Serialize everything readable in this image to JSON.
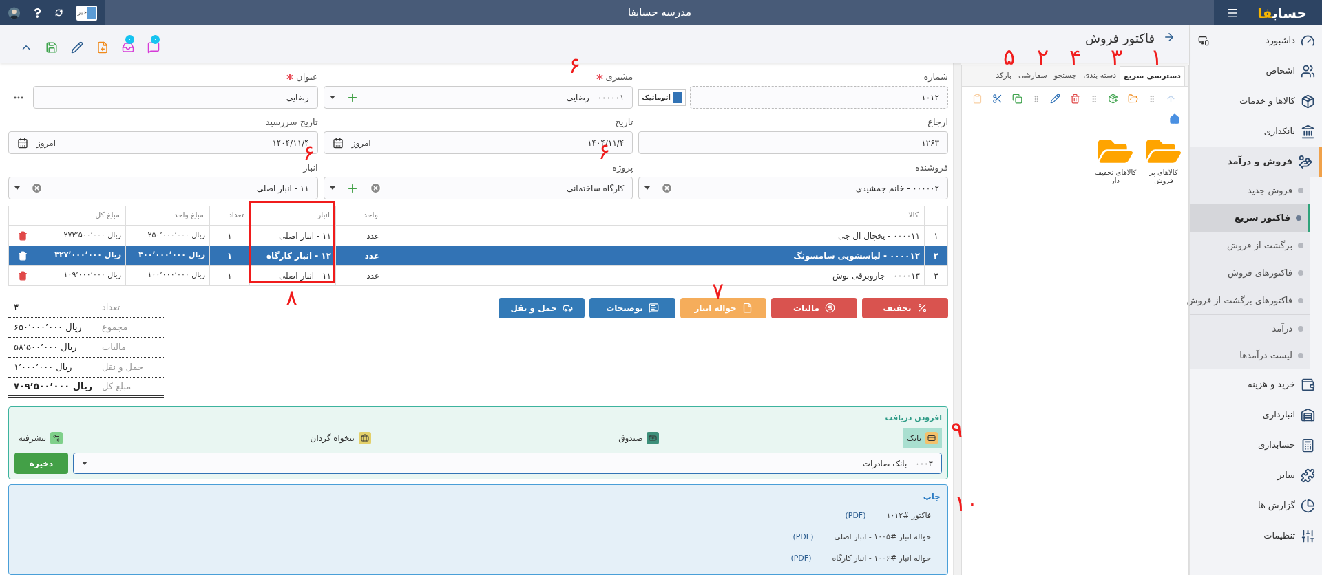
{
  "top_bar": {
    "logo": {
      "text": "حساب",
      "accent": "فا"
    },
    "title": "مدرسه حسابفا",
    "toggle": {
      "label": "خیر",
      "on": false
    }
  },
  "toolbar": [
    {
      "kind": "chat",
      "badge": "۰"
    },
    {
      "kind": "inbox",
      "badge": "۰"
    },
    {
      "kind": "new-file"
    },
    {
      "kind": "edit"
    },
    {
      "kind": "save"
    },
    {
      "kind": "collapse"
    }
  ],
  "sidebar": {
    "items": [
      {
        "label": "داشبورد",
        "kind": "dashboard",
        "expanded": false
      },
      {
        "label": "اشخاص",
        "kind": "people",
        "expanded": false
      },
      {
        "label": "کالاها و خدمات",
        "kind": "products",
        "expanded": false
      },
      {
        "label": "بانکداری",
        "kind": "banking",
        "expanded": false
      },
      {
        "label": "فروش و درآمد",
        "kind": "sales",
        "expanded": true,
        "children": [
          {
            "label": "فروش جدید",
            "selected": false,
            "kind": "item"
          },
          {
            "label": "فاکتور سریع",
            "selected": true,
            "kind": "item"
          },
          {
            "label": "برگشت از فروش",
            "selected": false,
            "kind": "item"
          },
          {
            "label": "فاکتورهای فروش",
            "selected": false,
            "kind": "item"
          },
          {
            "label": "فاکتورهای برگشت از فروش",
            "selected": false,
            "kind": "item"
          },
          {
            "label": "درآمد",
            "selected": false,
            "kind": "section-start"
          },
          {
            "label": "لیست درآمدها",
            "selected": false,
            "kind": "item"
          }
        ]
      },
      {
        "label": "خرید و هزینه",
        "kind": "purchases",
        "expanded": false
      },
      {
        "label": "انبارداری",
        "kind": "inventory",
        "expanded": false
      },
      {
        "label": "حسابداری",
        "kind": "accounting",
        "expanded": false
      },
      {
        "label": "سایر",
        "kind": "other",
        "expanded": false
      },
      {
        "label": "گزارش ها",
        "kind": "reports",
        "expanded": false
      },
      {
        "label": "تنظیمات",
        "kind": "settings",
        "expanded": false
      }
    ]
  },
  "quick_panel": {
    "title": "فاکتور فروش",
    "tabs": [
      {
        "label": "دسترسی سریع",
        "selected": true
      },
      {
        "label": "دسته بندی",
        "selected": false
      },
      {
        "label": "جستجو",
        "selected": false
      },
      {
        "label": "سفارشی",
        "selected": false
      },
      {
        "label": "بارکد",
        "selected": false
      }
    ],
    "tools": [
      {
        "kind": "up",
        "disabled": true
      },
      {
        "kind": "grip",
        "disabled": false
      },
      {
        "kind": "open-folder",
        "disabled": false
      },
      {
        "kind": "add",
        "disabled": false
      },
      {
        "kind": "grip",
        "disabled": false
      },
      {
        "kind": "delete",
        "disabled": false
      },
      {
        "kind": "edit",
        "disabled": false
      },
      {
        "kind": "grip",
        "disabled": false
      },
      {
        "kind": "copy",
        "disabled": false
      },
      {
        "kind": "cut",
        "disabled": false
      },
      {
        "kind": "paste",
        "disabled": true
      }
    ],
    "folders": [
      {
        "label": "کالاهای پر فروش"
      },
      {
        "label": "کالاهای تخفیف دار"
      }
    ]
  },
  "form": {
    "fields": [
      {
        "label": "شماره",
        "kind": "number",
        "required": false,
        "value": "۱۰۱۲",
        "auto": {
          "label": "اتوماتیک",
          "checked": true
        }
      },
      {
        "label": "مشتری",
        "kind": "select",
        "required": true,
        "value": "۰۰۰۰۰۱ - رضایی",
        "clearable": false,
        "addable": true
      },
      {
        "label": "عنوان",
        "kind": "text",
        "required": true,
        "value": "رضایی",
        "more": true
      },
      {
        "label": "ارجاع",
        "kind": "text",
        "required": false,
        "value": "۱۲۶۳",
        "more": false
      },
      {
        "label": "تاریخ",
        "kind": "date",
        "required": false,
        "value": "۱۴۰۴/۱۱/۴",
        "today": "امروز"
      },
      {
        "label": "تاریخ سررسید",
        "kind": "date",
        "required": false,
        "value": "۱۴۰۴/۱۱/۴",
        "today": "امروز"
      },
      {
        "label": "فروشنده",
        "kind": "select",
        "required": false,
        "value": "۰۰۰۰۰۲ - خانم جمشیدی",
        "clearable": true,
        "addable": false
      },
      {
        "label": "پروژه",
        "kind": "select",
        "required": false,
        "value": "کارگاه ساختمانی",
        "clearable": true,
        "addable": true
      },
      {
        "label": "انبار",
        "kind": "select",
        "required": false,
        "value": "۱۱ - انبار اصلی",
        "clearable": true,
        "addable": false
      }
    ]
  },
  "table": {
    "columns": [
      "کالا",
      "واحد",
      "انبار",
      "تعداد",
      "مبلغ واحد",
      "مبلغ کل"
    ],
    "rows": [
      {
        "index": "۱",
        "cells": [
          "۰۰۰۰۱۱ - یخچال ال جی",
          "عدد",
          "۱۱ - انبار اصلی",
          "۱",
          "ریال ۲۵۰٬۰۰۰٬۰۰۰",
          "ریال ۲۷۲٬۵۰۰٬۰۰۰"
        ],
        "selected": false
      },
      {
        "index": "۲",
        "cells": [
          "۰۰۰۰۱۲ - لباسشویی سامسونگ",
          "عدد",
          "۱۲ - انبار کارگاه",
          "۱",
          "ریال ۳۰۰٬۰۰۰٬۰۰۰",
          "ریال ۳۲۷٬۰۰۰٬۰۰۰"
        ],
        "selected": true
      },
      {
        "index": "۳",
        "cells": [
          "۰۰۰۰۱۳ - جاروبرقی بوش",
          "عدد",
          "۱۱ - انبار اصلی",
          "۱",
          "ریال ۱۰۰٬۰۰۰٬۰۰۰",
          "ریال ۱۰۹٬۰۰۰٬۰۰۰"
        ],
        "selected": false
      }
    ]
  },
  "actions": [
    {
      "label": "تخفیف",
      "kind": "discount"
    },
    {
      "label": "مالیات",
      "kind": "tax"
    },
    {
      "label": "حواله انبار",
      "kind": "warehouse-slip"
    },
    {
      "label": "توضیحات",
      "kind": "notes"
    },
    {
      "label": "حمل و نقل",
      "kind": "shipping"
    }
  ],
  "totals": [
    {
      "label": "تعداد",
      "value": "۳",
      "emphasis": false
    },
    {
      "label": "مجموع",
      "value": "ریال ۶۵۰٬۰۰۰٬۰۰۰",
      "emphasis": false
    },
    {
      "label": "مالیات",
      "value": "ریال ۵۸٬۵۰۰٬۰۰۰",
      "emphasis": false
    },
    {
      "label": "حمل و نقل",
      "value": "ریال ۱٬۰۰۰٬۰۰۰",
      "emphasis": false
    },
    {
      "label": "مبلغ کل",
      "value": "ریال ۷۰۹٬۵۰۰٬۰۰۰",
      "emphasis": true
    }
  ],
  "receipt": {
    "title": "افزودن دریافت",
    "methods": [
      {
        "label": "بانک",
        "kind": "bank",
        "selected": true
      },
      {
        "label": "صندوق",
        "kind": "cash",
        "selected": false
      },
      {
        "label": "تنخواه گردان",
        "kind": "petty",
        "selected": false
      },
      {
        "label": "پیشرفته",
        "kind": "advanced",
        "selected": false
      }
    ],
    "account": "۰۰۰۳ - بانک صادرات",
    "save": "ذخیره"
  },
  "print": {
    "title": "چاپ",
    "documents": [
      {
        "label": "فاکتور #۱۰۱۲",
        "format": "(PDF)"
      },
      {
        "label": "حواله انبار #۱۰۰۵ - انبار اصلی",
        "format": "(PDF)"
      },
      {
        "label": "حواله انبار #۱۰۰۶ - انبار کارگاه",
        "format": "(PDF)"
      }
    ]
  },
  "annotations": [
    {
      "kind": "number",
      "text": "۱"
    },
    {
      "kind": "number",
      "text": "۳"
    },
    {
      "kind": "number",
      "text": "۴"
    },
    {
      "kind": "number",
      "text": "۲"
    },
    {
      "kind": "number",
      "text": "۵"
    },
    {
      "kind": "number",
      "text": "۶"
    },
    {
      "kind": "number",
      "text": "۶"
    },
    {
      "kind": "number",
      "text": "۶"
    },
    {
      "kind": "box"
    },
    {
      "kind": "number",
      "text": "۷"
    },
    {
      "kind": "number",
      "text": "۸"
    },
    {
      "kind": "number",
      "text": "۹"
    },
    {
      "kind": "number",
      "text": "۱۰"
    }
  ]
}
